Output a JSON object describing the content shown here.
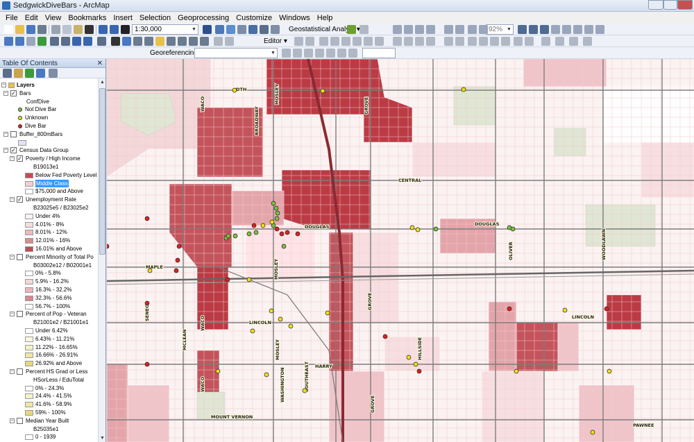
{
  "window": {
    "title": "SedgwickDiveBars - ArcMap"
  },
  "menu": [
    "File",
    "Edit",
    "View",
    "Bookmarks",
    "Insert",
    "Selection",
    "Geoprocessing",
    "Customize",
    "Windows",
    "Help"
  ],
  "toolbar": {
    "scale": "1:30,000",
    "geostat_label": "Geostatistical Analyst ▾",
    "zoom_percent": "92%",
    "editor_label": "Editor ▾",
    "georef_label": "Georeferencing ▾"
  },
  "toc": {
    "title": "Table Of Contents",
    "close": "✕",
    "rows": [
      {
        "level": 0,
        "exp": "−",
        "text": "Layers",
        "icon": "layers",
        "bold": true
      },
      {
        "level": 1,
        "exp": "−",
        "chk": true,
        "text": "Bars"
      },
      {
        "level": 3,
        "text": "ConfDive"
      },
      {
        "level": 3,
        "dot": "#7ac142",
        "text": "Not Dive Bar"
      },
      {
        "level": 3,
        "dot": "#f2e011",
        "text": "Unknown"
      },
      {
        "level": 3,
        "dot": "#e02020",
        "text": "Dive Bar"
      },
      {
        "level": 1,
        "exp": "−",
        "chk": false,
        "text": "Buffer_800mBars"
      },
      {
        "level": 3,
        "swatch": "#e3e3f5",
        "text": ""
      },
      {
        "level": 1,
        "exp": "−",
        "chk": true,
        "text": "Census Data Group"
      },
      {
        "level": 2,
        "exp": "−",
        "chk": true,
        "text": "Poverty / High Income"
      },
      {
        "level": 4,
        "text": "B19013e1"
      },
      {
        "level": 4,
        "swatch": "#c94a52",
        "text": "Below Fed Poverty Level"
      },
      {
        "level": 4,
        "swatch": "#f2cfd2",
        "text": "Middle Class",
        "selected": true
      },
      {
        "level": 4,
        "swatch": "#ffffff",
        "text": "$75,000 and Above"
      },
      {
        "level": 2,
        "exp": "−",
        "chk": true,
        "text": "Unemployment Rate"
      },
      {
        "level": 4,
        "text": "B23025e5 / B23025e2"
      },
      {
        "level": 4,
        "swatch": "#fdf3f3",
        "text": "Under 4%"
      },
      {
        "level": 4,
        "swatch": "#f6dcdd",
        "text": "4.01% - 8%"
      },
      {
        "level": 4,
        "swatch": "#eebabd",
        "text": "8.01% - 12%"
      },
      {
        "level": 4,
        "swatch": "#dd8a90",
        "text": "12.01% - 16%"
      },
      {
        "level": 4,
        "swatch": "#c24c55",
        "text": "16.01% and Above"
      },
      {
        "level": 2,
        "exp": "−",
        "chk": false,
        "text": "Percent Minority of Total Po"
      },
      {
        "level": 4,
        "text": "B03002e12 / B02001e1"
      },
      {
        "level": 4,
        "swatch": "#ffffff",
        "text": "0% - 5.8%"
      },
      {
        "level": 4,
        "swatch": "#f4d7d9",
        "text": "5.9% - 16.2%"
      },
      {
        "level": 4,
        "swatch": "#eab6ba",
        "text": "16.3% - 32.2%"
      },
      {
        "level": 4,
        "swatch": "#d98790",
        "text": "32.3% - 56.6%"
      },
      {
        "level": 4,
        "swatch": "#ffffff",
        "text": "56.7% - 100%"
      },
      {
        "level": 2,
        "exp": "−",
        "chk": false,
        "text": "Percent of Pop - Veteran"
      },
      {
        "level": 4,
        "text": "B21001e2 / B21001e1"
      },
      {
        "level": 4,
        "swatch": "#ffffff",
        "text": "Under 6.42%"
      },
      {
        "level": 4,
        "swatch": "#fbf7e0",
        "text": "6.43% - 11.21%"
      },
      {
        "level": 4,
        "swatch": "#f6f1c4",
        "text": "11.22% - 16.65%"
      },
      {
        "level": 4,
        "swatch": "#efe6a0",
        "text": "16.66% - 26.91%"
      },
      {
        "level": 4,
        "swatch": "#e6d879",
        "text": "26.92% and Above"
      },
      {
        "level": 2,
        "exp": "−",
        "chk": false,
        "text": "Percent HS Grad or Less"
      },
      {
        "level": 4,
        "text": "HSorLess / EduTotal"
      },
      {
        "level": 4,
        "swatch": "#ffffff",
        "text": "0% - 24.3%"
      },
      {
        "level": 4,
        "swatch": "#f7f2c8",
        "text": "24.4% - 41.5%"
      },
      {
        "level": 4,
        "swatch": "#f0e6a3",
        "text": "41.6% - 58.9%"
      },
      {
        "level": 4,
        "swatch": "#e8d77d",
        "text": "59% - 100%"
      },
      {
        "level": 2,
        "exp": "−",
        "chk": false,
        "text": "Median Year Built"
      },
      {
        "level": 4,
        "text": "B25035e1"
      },
      {
        "level": 4,
        "swatch": "#ffffff",
        "text": "0 - 1939"
      }
    ]
  },
  "map": {
    "roads": [
      "DTH",
      "WACO",
      "BROADWAY",
      "MOSLEY",
      "GROVE",
      "CENTRAL",
      "DOUGLAS",
      "DOUGLAS",
      "OLIVER",
      "WOODLAWN",
      "MAPLE",
      "MOSLEY",
      "GROVE",
      "SENECA",
      "WACO",
      "LINCOLN",
      "LINCOLN",
      "MOSLEY",
      "HILLSIDE",
      "HARRY",
      "MCLEAN",
      "WACO",
      "WASHINGTON",
      "SOUTHEAST",
      "GROVE",
      "MOUNT VERNON",
      "PAWNEE"
    ],
    "colors": {
      "poverty": "#b8323c",
      "middle": "#f3d6d8",
      "high": "#fbf1f1",
      "dive_bar": "#e02020",
      "unknown": "#f2e011",
      "not_dive": "#7ac142"
    }
  }
}
